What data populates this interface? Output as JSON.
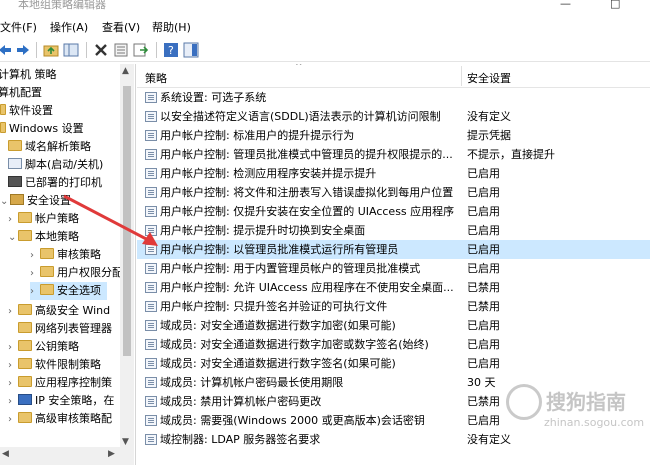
{
  "window": {
    "title": "本地组策略编辑器",
    "controls": [
      "—",
      "□"
    ]
  },
  "menu": [
    {
      "label": "文件(F)"
    },
    {
      "label": "操作(A)"
    },
    {
      "label": "查看(V)"
    },
    {
      "label": "帮助(H)"
    }
  ],
  "toolbar": {
    "icons": [
      "back-arrow-icon",
      "forward-arrow-icon",
      "up-folder-icon",
      "show-tree-icon",
      "delete-icon",
      "properties-icon",
      "export-icon",
      "help-icon",
      "help-pane-icon"
    ]
  },
  "tree": [
    {
      "label": "计算机 策略"
    },
    {
      "label": "算机配置"
    },
    {
      "label": "软件设置"
    },
    {
      "label": "Windows 设置"
    },
    {
      "label": "域名解析策略"
    },
    {
      "label": "脚本(启动/关机)"
    },
    {
      "label": "已部署的打印机"
    },
    {
      "label": "安全设置"
    },
    {
      "label": "帐户策略"
    },
    {
      "label": "本地策略"
    },
    {
      "label": "审核策略"
    },
    {
      "label": "用户权限分配"
    },
    {
      "label": "安全选项"
    },
    {
      "label": "高级安全 Wind"
    },
    {
      "label": "网络列表管理器"
    },
    {
      "label": "公钥策略"
    },
    {
      "label": "软件限制策略"
    },
    {
      "label": "应用程序控制策"
    },
    {
      "label": "IP 安全策略，在"
    },
    {
      "label": "高级审核策略配"
    }
  ],
  "table": {
    "col_policy": "策略",
    "col_setting": "安全设置",
    "rows": [
      {
        "name": "系统设置: 可选子系统",
        "value": ""
      },
      {
        "name": "以安全描述符定义语言(SDDL)语法表示的计算机访问限制",
        "value": "没有定义"
      },
      {
        "name": "用户帐户控制: 标准用户的提升提示行为",
        "value": "提示凭据"
      },
      {
        "name": "用户帐户控制: 管理员批准模式中管理员的提升权限提示的...",
        "value": "不提示，直接提升"
      },
      {
        "name": "用户帐户控制: 检测应用程序安装并提示提升",
        "value": "已启用"
      },
      {
        "name": "用户帐户控制: 将文件和注册表写入错误虚拟化到每用户位置",
        "value": "已启用"
      },
      {
        "name": "用户帐户控制: 仅提升安装在安全位置的 UIAccess 应用程序",
        "value": "已启用"
      },
      {
        "name": "用户帐户控制: 提示提升时切换到安全桌面",
        "value": "已启用"
      },
      {
        "name": "用户帐户控制: 以管理员批准模式运行所有管理员",
        "value": "已启用"
      },
      {
        "name": "用户帐户控制: 用于内置管理员帐户的管理员批准模式",
        "value": "已启用"
      },
      {
        "name": "用户帐户控制: 允许 UIAccess 应用程序在不使用安全桌面...",
        "value": "已禁用"
      },
      {
        "name": "用户帐户控制: 只提升签名并验证的可执行文件",
        "value": "已禁用"
      },
      {
        "name": "域成员: 对安全通道数据进行数字加密(如果可能)",
        "value": "已启用"
      },
      {
        "name": "域成员: 对安全通道数据进行数字加密或数字签名(始终)",
        "value": "已启用"
      },
      {
        "name": "域成员: 对安全通道数据进行数字签名(如果可能)",
        "value": "已启用"
      },
      {
        "name": "域成员: 计算机帐户密码最长使用期限",
        "value": "30 天"
      },
      {
        "name": "域成员: 禁用计算机帐户密码更改",
        "value": "已禁用"
      },
      {
        "name": "域成员: 需要强(Windows 2000 或更高版本)会话密钥",
        "value": "已启用"
      },
      {
        "name": "域控制器: LDAP 服务器签名要求",
        "value": "没有定义"
      }
    ]
  },
  "watermark": {
    "brand": "搜狗指南",
    "url": "zhinan.sogou.com"
  },
  "colors": {
    "selection": "#cce8ff",
    "arrow": "#e03a3a"
  }
}
